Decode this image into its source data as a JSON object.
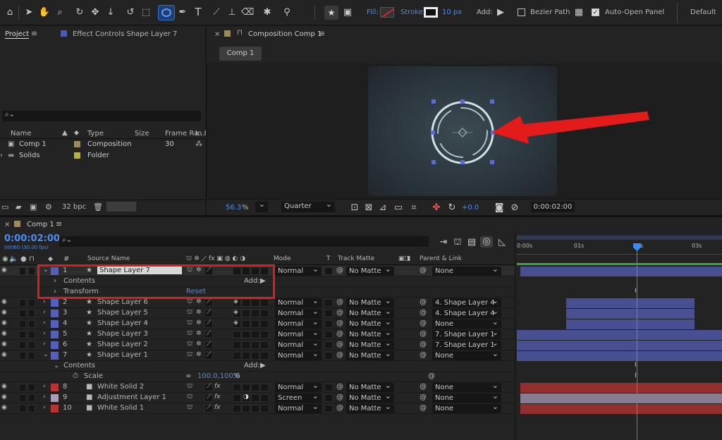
{
  "toolbar": {
    "fill_label": "Fill:",
    "stroke_label": "Stroke:",
    "stroke_width": "10 px",
    "add_label": "Add:",
    "bezier_label": "Bezier Path",
    "auto_open_label": "Auto-Open Panel",
    "workspace": "Default"
  },
  "project": {
    "tab_project": "Project",
    "tab_effect": "Effect Controls Shape Layer 7",
    "search_placeholder": "",
    "col_name": "Name",
    "col_type": "Type",
    "col_size": "Size",
    "col_framerate": "Frame Ra...",
    "col_in": "In P",
    "items": [
      {
        "name": "Comp 1",
        "type": "Composition",
        "framerate": "30"
      },
      {
        "name": "Solids",
        "type": "Folder",
        "framerate": ""
      }
    ],
    "bpc": "32 bpc"
  },
  "composition": {
    "tab": "Composition Comp 1",
    "comp_button": "Comp 1",
    "zoom": "56.3",
    "zoom_unit": "%",
    "resolution": "Quarter",
    "exposure": "+0.0",
    "timecode": "0:00:02:00"
  },
  "timeline": {
    "tab": "Comp 1",
    "timecode": "0:00:02:00",
    "fps": "00060 (30.00 fps)",
    "col_source": "Source Name",
    "col_mode": "Mode",
    "col_t": "T",
    "col_trackmatte": "Track Matte",
    "col_parent": "Parent & Link",
    "contents_label": "Contents",
    "transform_label": "Transform",
    "reset_label": "Reset",
    "add_label": "Add:",
    "scale_label": "Scale",
    "scale_value": "100.0,100.0",
    "scale_unit": "%",
    "ruler": [
      "0:00s",
      "01s",
      "02s",
      "03s"
    ],
    "layers": [
      {
        "num": "1",
        "name": "Shape Layer 7",
        "mode": "Normal",
        "matte": "No Matte",
        "parent": "None",
        "color": "#5560b8"
      },
      {
        "num": "2",
        "name": "Shape Layer 6",
        "mode": "Normal",
        "matte": "No Matte",
        "parent": "4. Shape Layer 4",
        "color": "#5560b8"
      },
      {
        "num": "3",
        "name": "Shape Layer 5",
        "mode": "Normal",
        "matte": "No Matte",
        "parent": "4. Shape Layer 4",
        "color": "#5560b8"
      },
      {
        "num": "4",
        "name": "Shape Layer 4",
        "mode": "Normal",
        "matte": "No Matte",
        "parent": "None",
        "color": "#5560b8"
      },
      {
        "num": "5",
        "name": "Shape Layer 3",
        "mode": "Normal",
        "matte": "No Matte",
        "parent": "7. Shape Layer 1",
        "color": "#5560b8"
      },
      {
        "num": "6",
        "name": "Shape Layer 2",
        "mode": "Normal",
        "matte": "No Matte",
        "parent": "7. Shape Layer 1",
        "color": "#5560b8"
      },
      {
        "num": "7",
        "name": "Shape Layer 1",
        "mode": "Normal",
        "matte": "No Matte",
        "parent": "None",
        "color": "#5560b8"
      },
      {
        "num": "8",
        "name": "White Solid 2",
        "mode": "Normal",
        "matte": "No Matte",
        "parent": "None",
        "color": "#b83434"
      },
      {
        "num": "9",
        "name": "Adjustment Layer 1",
        "mode": "Screen",
        "matte": "No Matte",
        "parent": "None",
        "color": "#a89cb8"
      },
      {
        "num": "10",
        "name": "White Solid 1",
        "mode": "Normal",
        "matte": "No Matte",
        "parent": "None",
        "color": "#b83434"
      }
    ]
  }
}
